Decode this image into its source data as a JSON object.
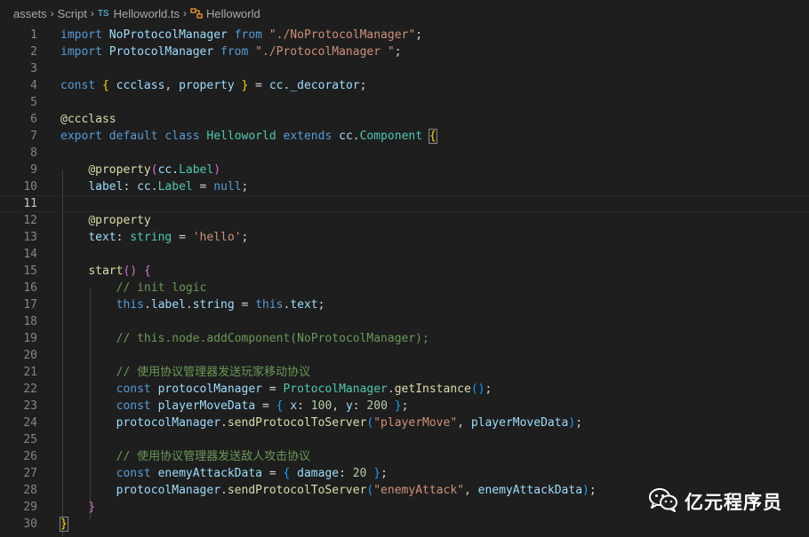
{
  "breadcrumb": {
    "items": [
      "assets",
      "Script",
      "Helloworld.ts",
      "Helloworld"
    ],
    "ts_badge": "TS"
  },
  "editor": {
    "current_line": 11,
    "line_numbers": [
      "1",
      "2",
      "3",
      "4",
      "5",
      "6",
      "7",
      "8",
      "9",
      "10",
      "11",
      "12",
      "13",
      "14",
      "15",
      "16",
      "17",
      "18",
      "19",
      "20",
      "21",
      "22",
      "23",
      "24",
      "25",
      "26",
      "27",
      "28",
      "29",
      "30"
    ],
    "lines": [
      [
        [
          "kw",
          "import"
        ],
        [
          "p",
          " "
        ],
        [
          "var",
          "NoProtocolManager"
        ],
        [
          "p",
          " "
        ],
        [
          "kw",
          "from"
        ],
        [
          "p",
          " "
        ],
        [
          "str",
          "\"./NoProtocolManager\""
        ],
        [
          "p",
          ";"
        ]
      ],
      [
        [
          "kw",
          "import"
        ],
        [
          "p",
          " "
        ],
        [
          "var",
          "ProtocolManager"
        ],
        [
          "p",
          " "
        ],
        [
          "kw",
          "from"
        ],
        [
          "p",
          " "
        ],
        [
          "str",
          "\"./ProtocolManager \""
        ],
        [
          "p",
          ";"
        ]
      ],
      [],
      [
        [
          "kw",
          "const"
        ],
        [
          "p",
          " "
        ],
        [
          "br1",
          "{"
        ],
        [
          "p",
          " "
        ],
        [
          "var",
          "ccclass"
        ],
        [
          "p",
          ", "
        ],
        [
          "var",
          "property"
        ],
        [
          "p",
          " "
        ],
        [
          "br1",
          "}"
        ],
        [
          "p",
          " = "
        ],
        [
          "var",
          "cc"
        ],
        [
          "p",
          "."
        ],
        [
          "var",
          "_decorator"
        ],
        [
          "p",
          ";"
        ]
      ],
      [],
      [
        [
          "fn",
          "@ccclass"
        ]
      ],
      [
        [
          "kw",
          "export"
        ],
        [
          "p",
          " "
        ],
        [
          "kw",
          "default"
        ],
        [
          "p",
          " "
        ],
        [
          "kw",
          "class"
        ],
        [
          "p",
          " "
        ],
        [
          "cls",
          "Helloworld"
        ],
        [
          "p",
          " "
        ],
        [
          "kw",
          "extends"
        ],
        [
          "p",
          " "
        ],
        [
          "var",
          "cc"
        ],
        [
          "p",
          "."
        ],
        [
          "cls",
          "Component"
        ],
        [
          "p",
          " "
        ],
        [
          "br1m",
          "{"
        ]
      ],
      [],
      [
        [
          "p",
          "    "
        ],
        [
          "fn",
          "@property"
        ],
        [
          "br2",
          "("
        ],
        [
          "var",
          "cc"
        ],
        [
          "p",
          "."
        ],
        [
          "cls",
          "Label"
        ],
        [
          "br2",
          ")"
        ]
      ],
      [
        [
          "p",
          "    "
        ],
        [
          "var",
          "label"
        ],
        [
          "p",
          ": "
        ],
        [
          "var",
          "cc"
        ],
        [
          "p",
          "."
        ],
        [
          "cls",
          "Label"
        ],
        [
          "p",
          " = "
        ],
        [
          "kw",
          "null"
        ],
        [
          "p",
          ";"
        ]
      ],
      [],
      [
        [
          "p",
          "    "
        ],
        [
          "fn",
          "@property"
        ]
      ],
      [
        [
          "p",
          "    "
        ],
        [
          "var",
          "text"
        ],
        [
          "p",
          ": "
        ],
        [
          "cls",
          "string"
        ],
        [
          "p",
          " = "
        ],
        [
          "str",
          "'hello'"
        ],
        [
          "p",
          ";"
        ]
      ],
      [],
      [
        [
          "p",
          "    "
        ],
        [
          "fn",
          "start"
        ],
        [
          "br2",
          "()"
        ],
        [
          "p",
          " "
        ],
        [
          "br2",
          "{"
        ]
      ],
      [
        [
          "p",
          "        "
        ],
        [
          "cmt",
          "// init logic"
        ]
      ],
      [
        [
          "p",
          "        "
        ],
        [
          "kw",
          "this"
        ],
        [
          "p",
          "."
        ],
        [
          "var",
          "label"
        ],
        [
          "p",
          "."
        ],
        [
          "var",
          "string"
        ],
        [
          "p",
          " = "
        ],
        [
          "kw",
          "this"
        ],
        [
          "p",
          "."
        ],
        [
          "var",
          "text"
        ],
        [
          "p",
          ";"
        ]
      ],
      [],
      [
        [
          "p",
          "        "
        ],
        [
          "cmt",
          "// this.node.addComponent(NoProtocolManager);"
        ]
      ],
      [],
      [
        [
          "p",
          "        "
        ],
        [
          "cmt",
          "// 使用协议管理器发送玩家移动协议"
        ]
      ],
      [
        [
          "p",
          "        "
        ],
        [
          "kw",
          "const"
        ],
        [
          "p",
          " "
        ],
        [
          "var",
          "protocolManager"
        ],
        [
          "p",
          " = "
        ],
        [
          "cls",
          "ProtocolManager"
        ],
        [
          "p",
          "."
        ],
        [
          "fn",
          "getInstance"
        ],
        [
          "br3",
          "()"
        ],
        [
          "p",
          ";"
        ]
      ],
      [
        [
          "p",
          "        "
        ],
        [
          "kw",
          "const"
        ],
        [
          "p",
          " "
        ],
        [
          "var",
          "playerMoveData"
        ],
        [
          "p",
          " = "
        ],
        [
          "br3",
          "{"
        ],
        [
          "p",
          " "
        ],
        [
          "var",
          "x"
        ],
        [
          "p",
          ": "
        ],
        [
          "num",
          "100"
        ],
        [
          "p",
          ", "
        ],
        [
          "var",
          "y"
        ],
        [
          "p",
          ": "
        ],
        [
          "num",
          "200"
        ],
        [
          "p",
          " "
        ],
        [
          "br3",
          "}"
        ],
        [
          "p",
          ";"
        ]
      ],
      [
        [
          "p",
          "        "
        ],
        [
          "var",
          "protocolManager"
        ],
        [
          "p",
          "."
        ],
        [
          "fn",
          "sendProtocolToServer"
        ],
        [
          "br3",
          "("
        ],
        [
          "str",
          "\"playerMove\""
        ],
        [
          "p",
          ", "
        ],
        [
          "var",
          "playerMoveData"
        ],
        [
          "br3",
          ")"
        ],
        [
          "p",
          ";"
        ]
      ],
      [],
      [
        [
          "p",
          "        "
        ],
        [
          "cmt",
          "// 使用协议管理器发送敌人攻击协议"
        ]
      ],
      [
        [
          "p",
          "        "
        ],
        [
          "kw",
          "const"
        ],
        [
          "p",
          " "
        ],
        [
          "var",
          "enemyAttackData"
        ],
        [
          "p",
          " = "
        ],
        [
          "br3",
          "{"
        ],
        [
          "p",
          " "
        ],
        [
          "var",
          "damage"
        ],
        [
          "p",
          ": "
        ],
        [
          "num",
          "20"
        ],
        [
          "p",
          " "
        ],
        [
          "br3",
          "}"
        ],
        [
          "p",
          ";"
        ]
      ],
      [
        [
          "p",
          "        "
        ],
        [
          "var",
          "protocolManager"
        ],
        [
          "p",
          "."
        ],
        [
          "fn",
          "sendProtocolToServer"
        ],
        [
          "br3",
          "("
        ],
        [
          "str",
          "\"enemyAttack\""
        ],
        [
          "p",
          ", "
        ],
        [
          "var",
          "enemyAttackData"
        ],
        [
          "br3",
          ")"
        ],
        [
          "p",
          ";"
        ]
      ],
      [
        [
          "p",
          "    "
        ],
        [
          "br2",
          "}"
        ]
      ],
      [
        [
          "br1m",
          "}"
        ]
      ]
    ]
  },
  "watermark": {
    "text": "亿元程序员",
    "icon": "wechat-icon"
  }
}
